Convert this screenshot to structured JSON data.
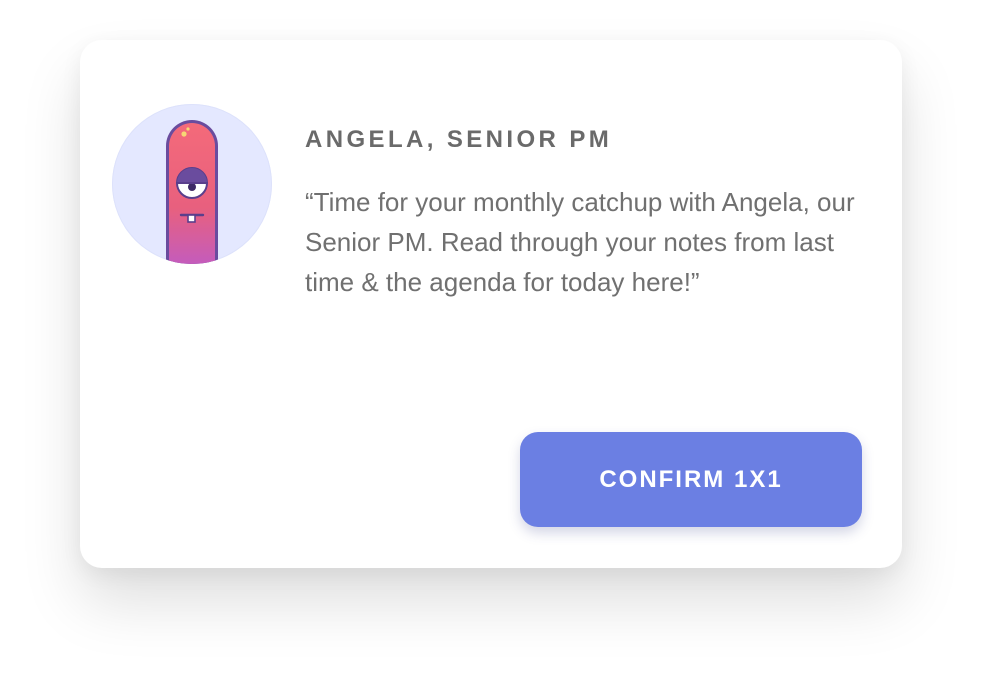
{
  "card": {
    "avatar_icon": "monster-avatar-icon",
    "name": "ANGELA, SENIOR PM",
    "message": "“Time for your monthly catchup with Angela, our Senior PM. Read through your notes from last time & the agenda for today here!”",
    "button_label": "CONFIRM 1X1"
  },
  "colors": {
    "accent": "#6b7fe3",
    "avatar_bg": "#e4e8ff",
    "monster_top": "#f46a7a",
    "monster_bottom": "#c45cbc",
    "text_heading": "#6a6a6a",
    "text_body": "#707070"
  }
}
